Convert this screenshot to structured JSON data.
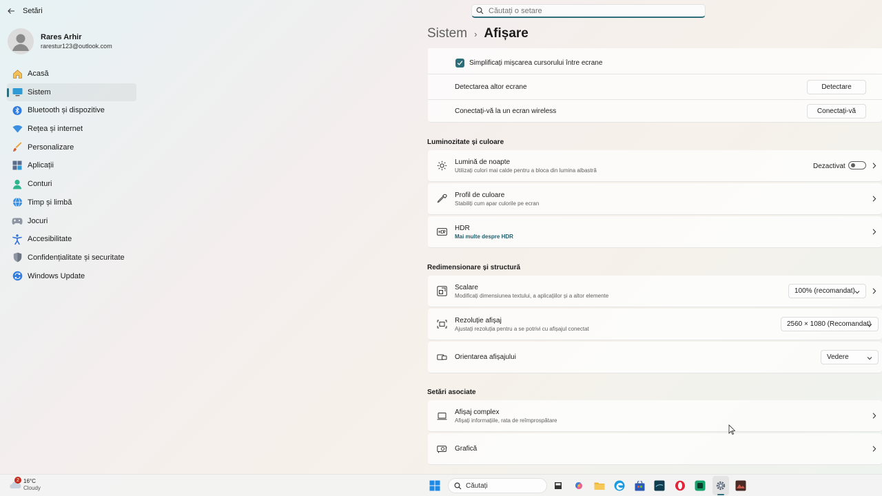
{
  "window": {
    "app_title": "Setări"
  },
  "search": {
    "placeholder": "Căutați o setare"
  },
  "profile": {
    "name": "Rares Arhir",
    "email": "rarestur123@outlook.com"
  },
  "sidebar": {
    "items": [
      {
        "label": "Acasă",
        "icon": "home-icon"
      },
      {
        "label": "Sistem",
        "icon": "system-icon",
        "active": true
      },
      {
        "label": "Bluetooth și dispozitive",
        "icon": "bluetooth-icon"
      },
      {
        "label": "Rețea și internet",
        "icon": "wifi-icon"
      },
      {
        "label": "Personalizare",
        "icon": "brush-icon"
      },
      {
        "label": "Aplicații",
        "icon": "apps-icon"
      },
      {
        "label": "Conturi",
        "icon": "account-icon"
      },
      {
        "label": "Timp și limbă",
        "icon": "globe-clock-icon"
      },
      {
        "label": "Jocuri",
        "icon": "gamepad-icon"
      },
      {
        "label": "Accesibilitate",
        "icon": "accessibility-icon"
      },
      {
        "label": "Confidențialitate și securitate",
        "icon": "shield-icon"
      },
      {
        "label": "Windows Update",
        "icon": "update-icon"
      }
    ]
  },
  "breadcrumb": {
    "parent": "Sistem",
    "separator": "›",
    "current": "Afișare"
  },
  "multi_display": {
    "ease_cursor": {
      "label": "Simplificați mișcarea cursorului între ecrane",
      "checked": true
    },
    "detect": {
      "label": "Detectarea altor ecrane",
      "button": "Detectare"
    },
    "wireless": {
      "label": "Conectați-vă la un ecran wireless",
      "button": "Conectați-vă"
    }
  },
  "brightness": {
    "heading": "Luminozitate și culoare",
    "night_light": {
      "title": "Lumină de noapte",
      "subtitle": "Utilizați culori mai calde pentru a bloca din lumina albastră",
      "status": "Dezactivat",
      "on": false
    },
    "color_profile": {
      "title": "Profil de culoare",
      "subtitle": "Stabiliți cum apar culorile pe ecran"
    },
    "hdr": {
      "title": "HDR",
      "link": "Mai multe despre HDR"
    }
  },
  "scale_layout": {
    "heading": "Redimensionare și structură",
    "scale": {
      "title": "Scalare",
      "subtitle": "Modificați dimensiunea textului, a aplicațiilor și a altor elemente",
      "value": "100% (recomandat)"
    },
    "resolution": {
      "title": "Rezoluție afișaj",
      "subtitle": "Ajustați rezoluția pentru a se  potrivi cu afișajul conectat",
      "value": "2560 × 1080 (Recomandat)"
    },
    "orientation": {
      "title": "Orientarea afișajului",
      "value": "Vedere"
    }
  },
  "related": {
    "heading": "Setări asociate",
    "advanced": {
      "title": "Afișaj complex",
      "subtitle": "Afișați informațiile, rata de reîmprospătare"
    },
    "graphics": {
      "title": "Grafică"
    }
  },
  "taskbar": {
    "weather": {
      "temp": "16°C",
      "condition": "Cloudy",
      "badge": "2"
    },
    "search_label": "Căutați"
  },
  "colors": {
    "accent": "#2d6e7a"
  }
}
